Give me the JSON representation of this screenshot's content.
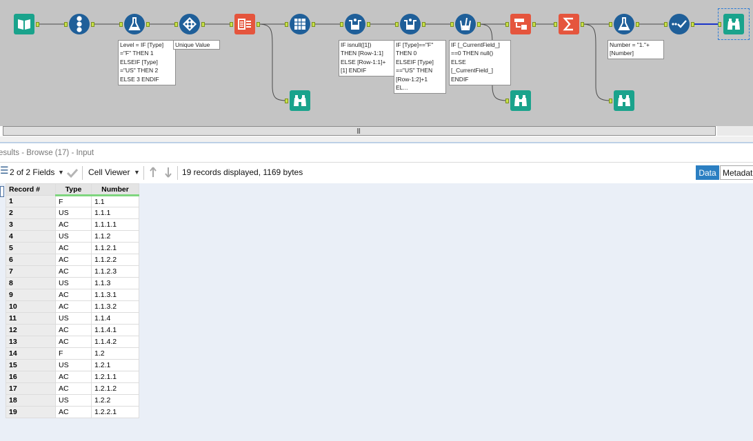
{
  "canvas": {
    "annotations": [
      "Level = IF [Type]\n=\"F\" THEN 1\nELSEIF [Type]\n=\"US\" THEN 2\nELSE 3 ENDIF",
      "Unique Value",
      "IF isnull([1])\nTHEN [Row-1:1]\nELSE [Row-1:1]+\n[1] ENDIF",
      "IF [Type]==\"F\"\nTHEN 0\nELSEIF [Type]\n==\"US\" THEN\n[Row-1:2]+1\nEL...",
      "IF [_CurrentField_]\n==0 THEN null()\nELSE\n[_CurrentField_]\nENDIF",
      "Number = \"1.\"+\n[Number]"
    ],
    "colors": {
      "input_green": "#1aa38c",
      "blue_tool": "#1f5f99",
      "red_tool": "#e5553d",
      "anchor": "#c8e049"
    }
  },
  "results": {
    "title": "esults - Browse (17) - Input",
    "fields_label": "2 of 2 Fields",
    "viewer_label": "Cell Viewer",
    "status": "19 records displayed, 1169 bytes",
    "tab_data": "Data",
    "tab_metadata": "Metadat",
    "columns": [
      "Record #",
      "Type",
      "Number"
    ],
    "rows": [
      [
        "1",
        "F",
        "1.1"
      ],
      [
        "2",
        "US",
        "1.1.1"
      ],
      [
        "3",
        "AC",
        "1.1.1.1"
      ],
      [
        "4",
        "US",
        "1.1.2"
      ],
      [
        "5",
        "AC",
        "1.1.2.1"
      ],
      [
        "6",
        "AC",
        "1.1.2.2"
      ],
      [
        "7",
        "AC",
        "1.1.2.3"
      ],
      [
        "8",
        "US",
        "1.1.3"
      ],
      [
        "9",
        "AC",
        "1.1.3.1"
      ],
      [
        "10",
        "AC",
        "1.1.3.2"
      ],
      [
        "11",
        "US",
        "1.1.4"
      ],
      [
        "12",
        "AC",
        "1.1.4.1"
      ],
      [
        "13",
        "AC",
        "1.1.4.2"
      ],
      [
        "14",
        "F",
        "1.2"
      ],
      [
        "15",
        "US",
        "1.2.1"
      ],
      [
        "16",
        "AC",
        "1.2.1.1"
      ],
      [
        "17",
        "AC",
        "1.2.1.2"
      ],
      [
        "18",
        "US",
        "1.2.2"
      ],
      [
        "19",
        "AC",
        "1.2.2.1"
      ]
    ]
  }
}
